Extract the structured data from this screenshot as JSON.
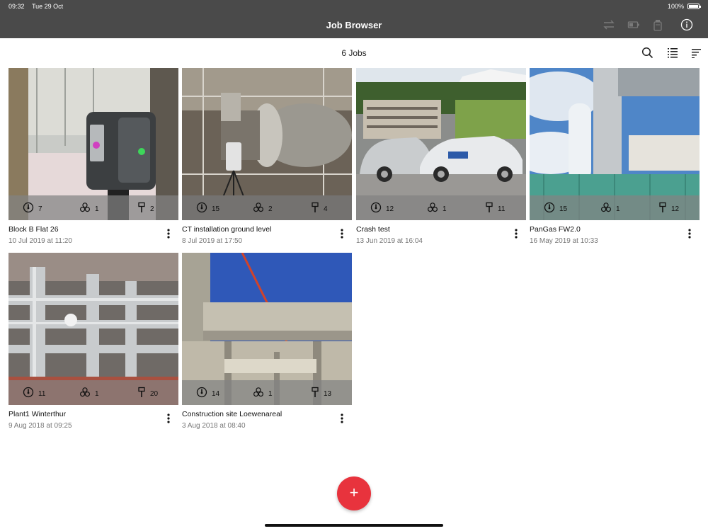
{
  "status_bar": {
    "time": "09:32",
    "date": "Tue 29 Oct",
    "battery": "100%"
  },
  "nav": {
    "title": "Job Browser"
  },
  "toolbar": {
    "count_label": "6 Jobs"
  },
  "jobs": [
    {
      "name": "Block B Flat 26",
      "date": "10 Jul 2019 at 11:20",
      "setups": "7",
      "scans": "1",
      "targets": "2"
    },
    {
      "name": "CT installation ground level",
      "date": "8 Jul 2019 at 17:50",
      "setups": "15",
      "scans": "2",
      "targets": "4"
    },
    {
      "name": "Crash test",
      "date": "13 Jun 2019 at 16:04",
      "setups": "12",
      "scans": "1",
      "targets": "11"
    },
    {
      "name": "PanGas FW2.0",
      "date": "16 May 2019 at 10:33",
      "setups": "15",
      "scans": "1",
      "targets": "12"
    },
    {
      "name": "Plant1 Winterthur",
      "date": "9 Aug 2018 at 09:25",
      "setups": "11",
      "scans": "1",
      "targets": "20"
    },
    {
      "name": "Construction site Loewenareal",
      "date": "3 Aug 2018 at 08:40",
      "setups": "14",
      "scans": "1",
      "targets": "13"
    }
  ],
  "fab": {
    "label": "+"
  },
  "colors": {
    "bar": "#4a4a4a",
    "accent": "#e8333d"
  }
}
